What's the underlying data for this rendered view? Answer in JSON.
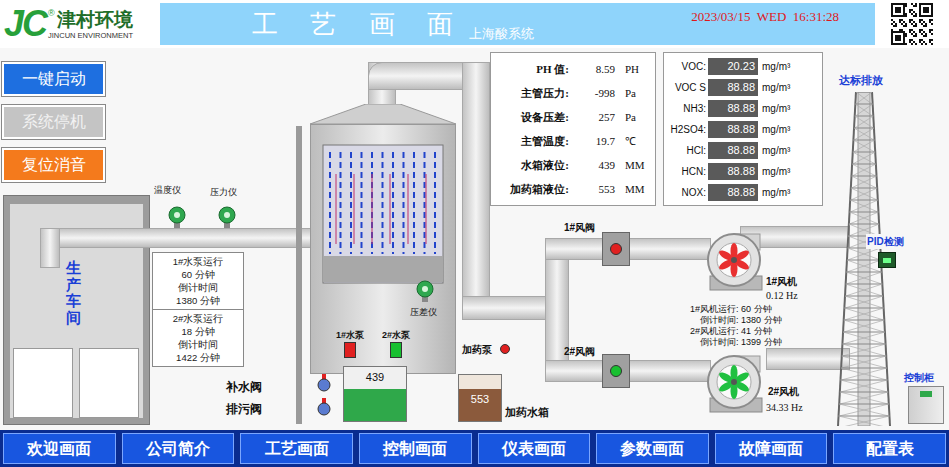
{
  "header": {
    "logo_mark": "JC",
    "registered": "®",
    "company": "津村环境",
    "company_en": "JINCUN ENVIRONMENT",
    "title": "工 艺 画 面",
    "subtitle": "上海酸系统",
    "datetime": "2023/03/15  WED  16:31:28"
  },
  "control_buttons": [
    {
      "label": "一键启动",
      "disabled": false,
      "color": "#1e6fe0"
    },
    {
      "label": "系统停机",
      "disabled": true,
      "color": "#c4c4c4"
    },
    {
      "label": "复位消音",
      "disabled": false,
      "color": "#f47a1c"
    }
  ],
  "process_readings": [
    {
      "label": "PH 值:",
      "value": "8.59",
      "unit": "PH"
    },
    {
      "label": "主管压力:",
      "value": "-998",
      "unit": "Pa"
    },
    {
      "label": "设备压差:",
      "value": "257",
      "unit": "Pa"
    },
    {
      "label": "主管温度:",
      "value": "19.7",
      "unit": "℃"
    },
    {
      "label": "水箱液位:",
      "value": "439",
      "unit": "MM"
    },
    {
      "label": "加药箱液位:",
      "value": "553",
      "unit": "MM"
    }
  ],
  "gas_readings": [
    {
      "label": "VOC:",
      "value": "20.23",
      "unit": "mg/m³"
    },
    {
      "label": "VOC S",
      "value": "88.88",
      "unit": "mg/m³"
    },
    {
      "label": "NH3:",
      "value": "88.88",
      "unit": "mg/m³"
    },
    {
      "label": "H2SO4:",
      "value": "88.88",
      "unit": "mg/m³"
    },
    {
      "label": "HCl:",
      "value": "88.88",
      "unit": "mg/m³"
    },
    {
      "label": "HCN:",
      "value": "88.88",
      "unit": "mg/m³"
    },
    {
      "label": "NOX:",
      "value": "88.88",
      "unit": "mg/m³"
    }
  ],
  "workshop": {
    "label": "生产车间"
  },
  "instruments": {
    "temperature": "温度仪",
    "pressure": "压力仪",
    "differential": "压差仪"
  },
  "water_pumps": [
    {
      "name": "1#水泵",
      "running": false,
      "color": "#e02020",
      "run_label": "1#水泵运行",
      "run_value": "60 分钟",
      "countdown_label": "倒计时间",
      "countdown_value": "1380 分钟"
    },
    {
      "name": "2#水泵",
      "running": true,
      "color": "#18c030",
      "run_label": "2#水泵运行",
      "run_value": "18 分钟",
      "countdown_label": "倒计时间",
      "countdown_value": "1422 分钟"
    }
  ],
  "water_valves": [
    {
      "label": "补水阀"
    },
    {
      "label": "排污阀"
    }
  ],
  "water_tank": {
    "reading": "439",
    "level": 0.6
  },
  "dosing": {
    "pump_label": "加药泵",
    "pump_color": "#e02020",
    "tank_reading": "553",
    "tank_level": 0.7,
    "tank_label": "加药水箱"
  },
  "air_valves": [
    {
      "label": "1#风阀",
      "open": false,
      "color": "#e02020"
    },
    {
      "label": "2#风阀",
      "open": true,
      "color": "#18c030"
    }
  ],
  "fans": [
    {
      "name": "1#风机",
      "frequency": "0.12 Hz",
      "running": false,
      "color": "#e83030"
    },
    {
      "name": "2#风机",
      "frequency": "34.33 Hz",
      "running": true,
      "color": "#20c040"
    }
  ],
  "fan_runtime": [
    "1#风机运行: 60 分钟",
    "倒计时间: 1380 分钟",
    "2#风机运行: 41 分钟",
    "倒计时间: 1399 分钟"
  ],
  "stack": {
    "label": "达标排放",
    "pid_label": "PID检测",
    "cabinet_label": "控制柜"
  },
  "nav": [
    "欢迎画面",
    "公司简介",
    "工艺画面",
    "控制画面",
    "仪表画面",
    "参数画面",
    "故障画面",
    "配置表"
  ]
}
